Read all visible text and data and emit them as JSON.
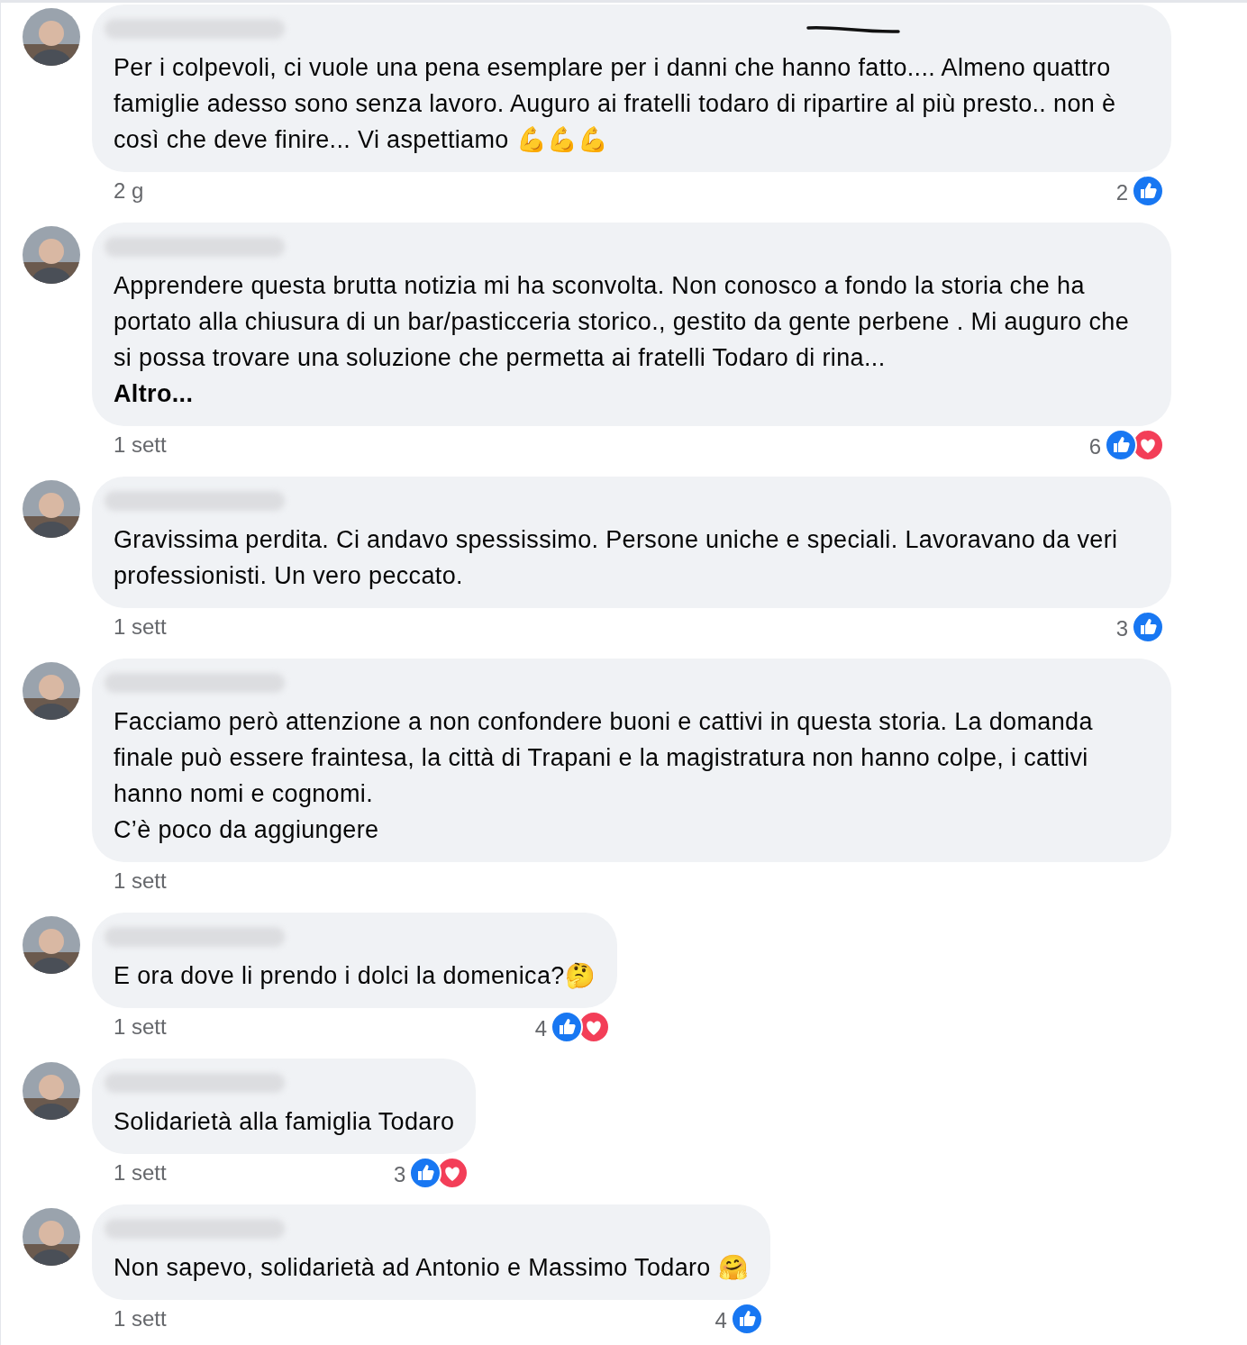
{
  "comments": [
    {
      "name_hidden": true,
      "text": "Per i colpevoli, ci vuole una pena esemplare per i danni che hanno fatto.... Almeno quattro famiglie adesso sono senza lavoro. Auguro ai fratelli todaro di ripartire al più presto.. non è così che deve finire... Vi aspettiamo 💪💪💪",
      "time": "2 g",
      "reaction_count": "2",
      "reactions": [
        {
          "kind": "like"
        }
      ],
      "scribble": true
    },
    {
      "name_hidden": true,
      "text": "Apprendere questa brutta notizia mi ha sconvolta. Non conosco a fondo la storia che ha portato alla chiusura di un bar/pasticceria storico., gestito da gente perbene . Mi auguro che si possa trovare una soluzione che permetta ai fratelli Todaro di rina...",
      "more": "Altro...",
      "time": "1 sett",
      "reaction_count": "6",
      "reactions": [
        {
          "kind": "like"
        },
        {
          "kind": "love"
        }
      ]
    },
    {
      "name_hidden": true,
      "text": "Gravissima perdita. Ci andavo spessissimo. Persone uniche e speciali. Lavoravano da veri professionisti. Un vero peccato.",
      "time": "1 sett",
      "reaction_count": "3",
      "reactions": [
        {
          "kind": "like"
        }
      ]
    },
    {
      "name_hidden": true,
      "text": "Facciamo però attenzione a non confondere buoni e cattivi in questa storia. La domanda finale può essere fraintesa, la città di Trapani e la magistratura non hanno colpe, i cattivi hanno nomi e cognomi.\nC’è poco da aggiungere",
      "time": "1 sett"
    },
    {
      "name_hidden": true,
      "text": "E ora dove li prendo i dolci la domenica?🤔",
      "time": "1 sett",
      "reaction_count": "4",
      "reactions": [
        {
          "kind": "like"
        },
        {
          "kind": "love"
        }
      ]
    },
    {
      "name_hidden": true,
      "text": "Solidarietà alla famiglia Todaro",
      "time": "1 sett",
      "reaction_count": "3",
      "reactions": [
        {
          "kind": "like"
        },
        {
          "kind": "love"
        }
      ]
    },
    {
      "name_hidden": true,
      "text": "Non sapevo, solidarietà ad Antonio e Massimo Todaro 🤗",
      "time": "1 sett",
      "reaction_count": "4",
      "reactions": [
        {
          "kind": "like"
        }
      ]
    }
  ]
}
